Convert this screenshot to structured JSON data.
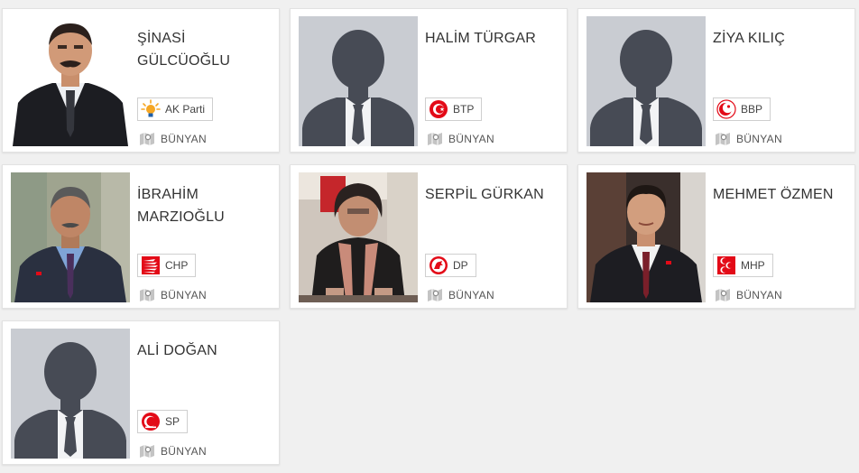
{
  "candidates": [
    {
      "name": "ŞİNASİ\nGÜLCÜOĞLU",
      "party": "AK Parti",
      "party_icon": "akp-bulb-icon",
      "location": "BÜNYAN",
      "photo": "photo"
    },
    {
      "name": "HALİM TÜRGAR",
      "party": "BTP",
      "party_icon": "btp-logo-icon",
      "location": "BÜNYAN",
      "photo": "placeholder"
    },
    {
      "name": "ZİYA KILIÇ",
      "party": "BBP",
      "party_icon": "bbp-logo-icon",
      "location": "BÜNYAN",
      "photo": "placeholder"
    },
    {
      "name": "İBRAHİM\nMARZIOĞLU",
      "party": "CHP",
      "party_icon": "chp-arrows-icon",
      "location": "BÜNYAN",
      "photo": "photo"
    },
    {
      "name": "SERPİL GÜRKAN",
      "party": "DP",
      "party_icon": "dp-horse-icon",
      "location": "BÜNYAN",
      "photo": "photo"
    },
    {
      "name": "MEHMET ÖZMEN",
      "party": "MHP",
      "party_icon": "mhp-crescents-icon",
      "location": "BÜNYAN",
      "photo": "photo"
    },
    {
      "name": "ALİ DOĞAN",
      "party": "SP",
      "party_icon": "sp-logo-icon",
      "location": "BÜNYAN",
      "photo": "placeholder"
    }
  ],
  "colors": {
    "page_bg": "#f0f0f0",
    "card_bg": "#ffffff",
    "placeholder_bg": "#c9ccd2",
    "placeholder_silhouette": "#474b55",
    "akp": "#f5a623",
    "party_red": "#e30a17",
    "text": "#333333"
  }
}
